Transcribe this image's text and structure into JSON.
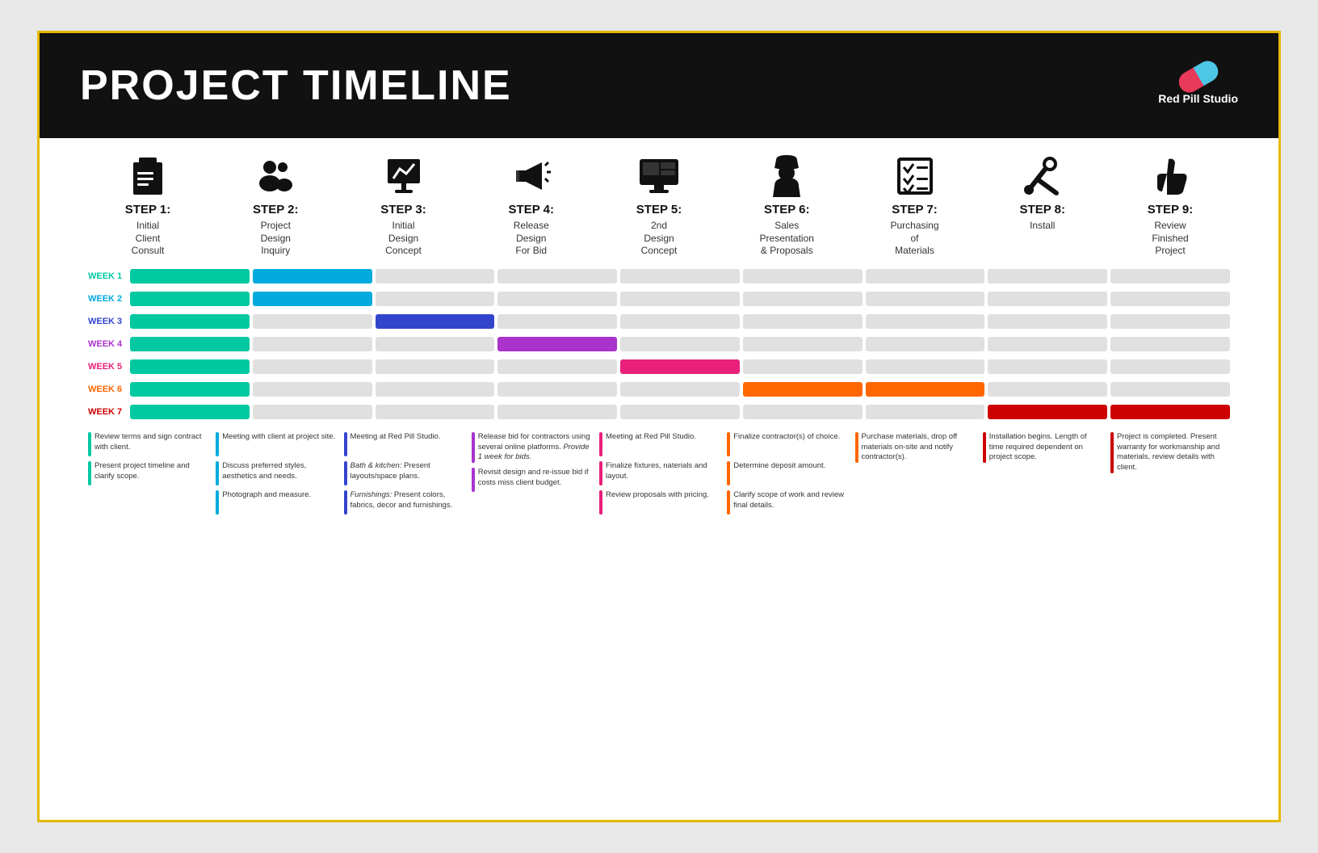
{
  "header": {
    "title": "PROJECT TIMELINE",
    "logo_text": "Red Pill Studio"
  },
  "steps": [
    {
      "id": 1,
      "label": "STEP 1:",
      "desc": "Initial\nClient\nConsult",
      "icon": "📋"
    },
    {
      "id": 2,
      "label": "STEP 2:",
      "desc": "Project\nDesign\nInquiry",
      "icon": "👥"
    },
    {
      "id": 3,
      "label": "STEP 3:",
      "desc": "Initial\nDesign\nConcept",
      "icon": "📈"
    },
    {
      "id": 4,
      "label": "STEP 4:",
      "desc": "Release\nDesign\nFor Bid",
      "icon": "📣"
    },
    {
      "id": 5,
      "label": "STEP 5:",
      "desc": "2nd\nDesign\nConcept",
      "icon": "🖥"
    },
    {
      "id": 6,
      "label": "STEP 6:",
      "desc": "Sales\nPresentation\n& Proposals",
      "icon": "👷"
    },
    {
      "id": 7,
      "label": "STEP 7:",
      "desc": "Purchasing\nof\nMaterials",
      "icon": "✅"
    },
    {
      "id": 8,
      "label": "STEP 8:",
      "desc": "Install",
      "icon": "🔧"
    },
    {
      "id": 9,
      "label": "STEP 9:",
      "desc": "Review\nFinished\nProject",
      "icon": "👍"
    }
  ],
  "weeks": [
    {
      "label": "WEEK 1",
      "label_color": "#00c8a0",
      "cells": [
        {
          "active": true,
          "color": "#00c8a0"
        },
        {
          "active": true,
          "color": "#00aadd"
        },
        {
          "active": false
        },
        {
          "active": false
        },
        {
          "active": false
        },
        {
          "active": false
        },
        {
          "active": false
        },
        {
          "active": false
        },
        {
          "active": false
        }
      ]
    },
    {
      "label": "WEEK 2",
      "label_color": "#00aadd",
      "cells": [
        {
          "active": true,
          "color": "#00c8a0"
        },
        {
          "active": true,
          "color": "#00aadd"
        },
        {
          "active": false
        },
        {
          "active": false
        },
        {
          "active": false
        },
        {
          "active": false
        },
        {
          "active": false
        },
        {
          "active": false
        },
        {
          "active": false
        }
      ]
    },
    {
      "label": "WEEK 3",
      "label_color": "#3344cc",
      "cells": [
        {
          "active": true,
          "color": "#00c8a0"
        },
        {
          "active": false
        },
        {
          "active": true,
          "color": "#3344cc"
        },
        {
          "active": false
        },
        {
          "active": false
        },
        {
          "active": false
        },
        {
          "active": false
        },
        {
          "active": false
        },
        {
          "active": false
        }
      ]
    },
    {
      "label": "WEEK 4",
      "label_color": "#aa33cc",
      "cells": [
        {
          "active": true,
          "color": "#00c8a0"
        },
        {
          "active": false
        },
        {
          "active": false
        },
        {
          "active": true,
          "color": "#aa33cc"
        },
        {
          "active": false
        },
        {
          "active": false
        },
        {
          "active": false
        },
        {
          "active": false
        },
        {
          "active": false
        }
      ]
    },
    {
      "label": "WEEK 5",
      "label_color": "#e8207a",
      "cells": [
        {
          "active": true,
          "color": "#00c8a0"
        },
        {
          "active": false
        },
        {
          "active": false
        },
        {
          "active": false
        },
        {
          "active": true,
          "color": "#e8207a"
        },
        {
          "active": false
        },
        {
          "active": false
        },
        {
          "active": false
        },
        {
          "active": false
        }
      ]
    },
    {
      "label": "WEEK 6",
      "label_color": "#ff6600",
      "cells": [
        {
          "active": true,
          "color": "#00c8a0"
        },
        {
          "active": false
        },
        {
          "active": false
        },
        {
          "active": false
        },
        {
          "active": false
        },
        {
          "active": true,
          "color": "#ff6600"
        },
        {
          "active": true,
          "color": "#ff6600"
        },
        {
          "active": false
        },
        {
          "active": false
        }
      ]
    },
    {
      "label": "WEEK 7",
      "label_color": "#cc0000",
      "cells": [
        {
          "active": true,
          "color": "#00c8a0"
        },
        {
          "active": false
        },
        {
          "active": false
        },
        {
          "active": false
        },
        {
          "active": false
        },
        {
          "active": false
        },
        {
          "active": false
        },
        {
          "active": true,
          "color": "#cc0000"
        },
        {
          "active": true,
          "color": "#cc0000"
        }
      ]
    }
  ],
  "notes": [
    {
      "blocks": [
        {
          "color": "#00c8a0",
          "text": "Review terms and sign contract with client."
        },
        {
          "color": "#00c8a0",
          "text": "Present project timeline and clarify scope."
        }
      ]
    },
    {
      "blocks": [
        {
          "color": "#00aadd",
          "text": "Meeting with client at project site."
        },
        {
          "color": "#00aadd",
          "text": "Discuss preferred styles, aesthetics and needs."
        },
        {
          "color": "#00aadd",
          "text": "Photograph and measure."
        }
      ]
    },
    {
      "blocks": [
        {
          "color": "#3344cc",
          "text": "Meeting at Red Pill Studio."
        },
        {
          "color": "#3344cc",
          "text": "<em>Bath & kitchen:</em> Present layouts/space plans."
        },
        {
          "color": "#3344cc",
          "text": "<em>Furnishings:</em> Present colors, fabrics, decor and furnishings."
        }
      ]
    },
    {
      "blocks": [
        {
          "color": "#aa33cc",
          "text": "Release bid for contractors using several online platforms. <em>Provide 1 week for bids.</em>"
        },
        {
          "color": "#aa33cc",
          "text": "Revisit design and re-issue bid if costs miss client budget."
        }
      ]
    },
    {
      "blocks": [
        {
          "color": "#e8207a",
          "text": "Meeting at Red Pill Studio."
        },
        {
          "color": "#e8207a",
          "text": "Finalize fixtures, naterials and layout."
        },
        {
          "color": "#e8207a",
          "text": "Review proposals with pricing."
        }
      ]
    },
    {
      "blocks": [
        {
          "color": "#ff6600",
          "text": "Finalize contractor(s) of choice."
        },
        {
          "color": "#ff6600",
          "text": "Determine deposit amount."
        },
        {
          "color": "#ff6600",
          "text": "Clarify scope of work and review final details."
        }
      ]
    },
    {
      "blocks": [
        {
          "color": "#ff6600",
          "text": "Purchase materials, drop off materials on-site and notify contractor(s)."
        }
      ]
    },
    {
      "blocks": [
        {
          "color": "#cc0000",
          "text": "Installation begins. Length of time required dependent on project scope."
        }
      ]
    },
    {
      "blocks": [
        {
          "color": "#cc0000",
          "text": "Project is completed. Present warranty for workmanship and materials, review details with client."
        }
      ]
    }
  ]
}
